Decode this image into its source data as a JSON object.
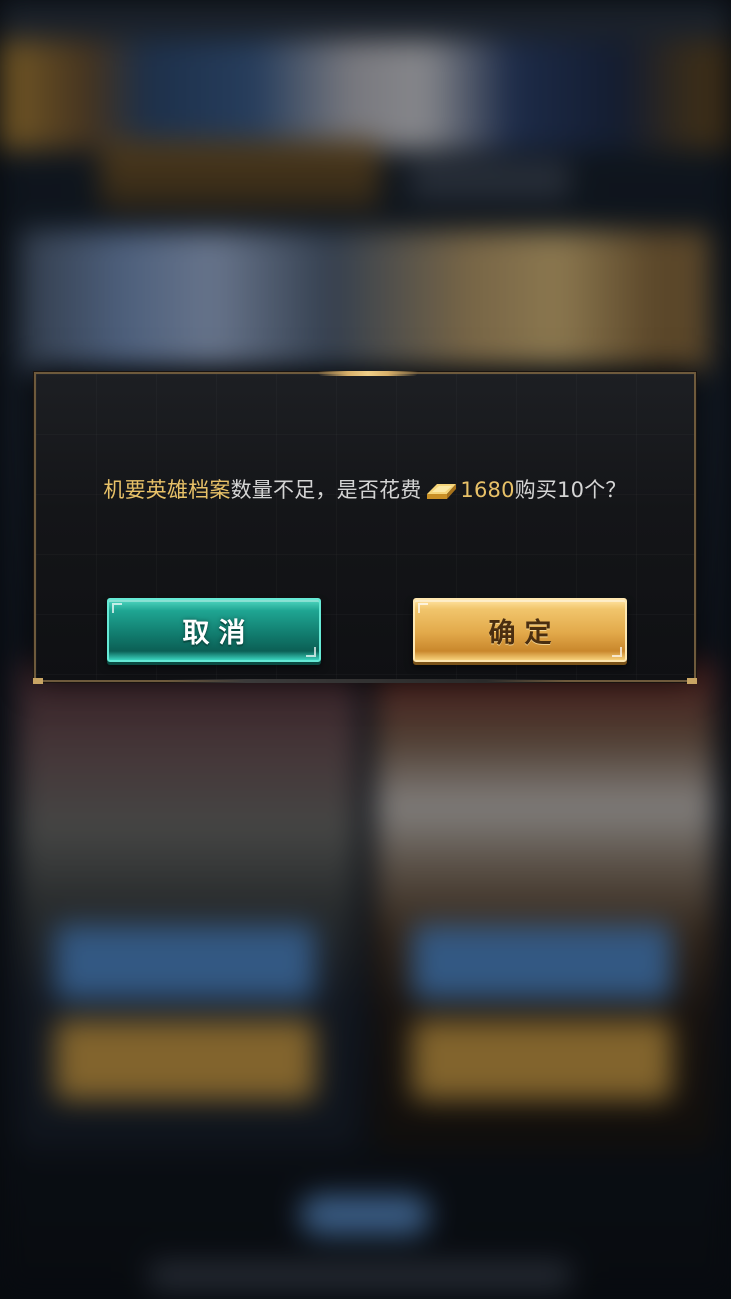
{
  "dialog": {
    "message": {
      "item_name": "机要英雄档案",
      "text_before_cost": "数量不足，是否花费",
      "currency_icon": "gold-bar-icon",
      "cost": "1680",
      "text_after_cost": "购买10个？"
    },
    "cancel_label": "取消",
    "confirm_label": "确定"
  },
  "colors": {
    "highlight": "#e8c168",
    "cancel_button": "#1fa592",
    "confirm_button": "#e2a94a",
    "dialog_border": "#6e5a3c"
  }
}
